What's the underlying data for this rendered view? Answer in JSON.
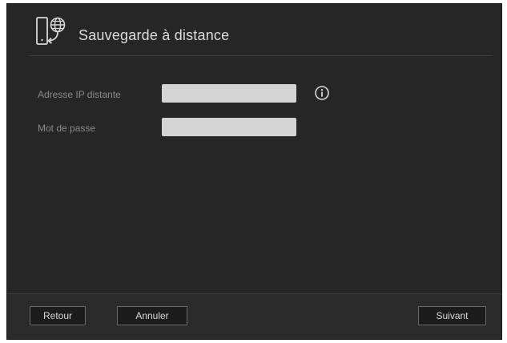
{
  "dialog": {
    "title": "Sauvegarde à distance",
    "icon": "remote-backup-icon"
  },
  "form": {
    "remote_ip": {
      "label": "Adresse IP distante",
      "value": "",
      "placeholder": ""
    },
    "password": {
      "label": "Mot de passe",
      "value": "",
      "placeholder": ""
    },
    "info_icon": "info-icon"
  },
  "footer": {
    "back_label": "Retour",
    "cancel_label": "Annuler",
    "next_label": "Suivant"
  },
  "colors": {
    "dialog_bg": "#262626",
    "input_bg": "#d4d4d4",
    "label_text": "#8a8a8a",
    "title_text": "#dcdcdc"
  }
}
